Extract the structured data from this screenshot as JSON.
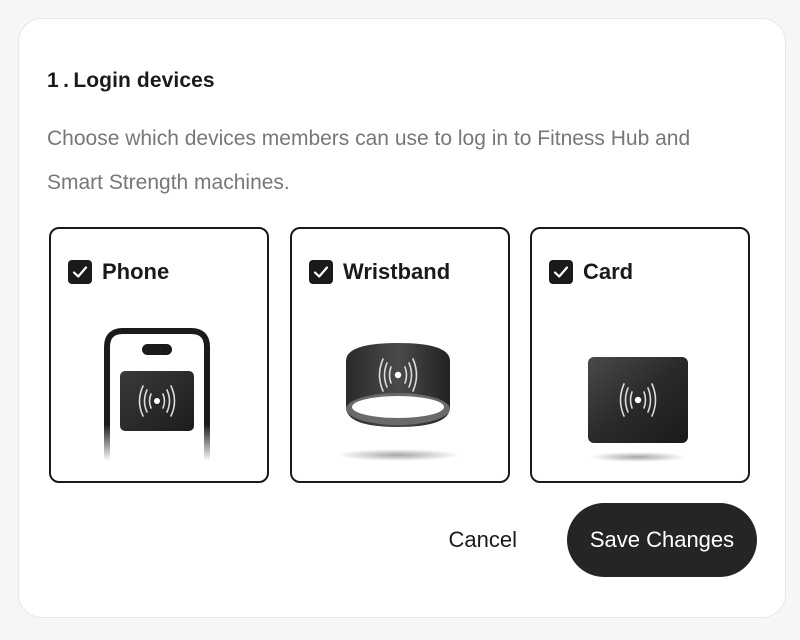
{
  "section": {
    "title": "1 . Login devices",
    "description": "Choose which devices members can use to log in to Fitness Hub and Smart Strength machines."
  },
  "devices": [
    {
      "label": "Phone",
      "checked": true,
      "icon": "phone-nfc-icon"
    },
    {
      "label": "Wristband",
      "checked": true,
      "icon": "wristband-nfc-icon"
    },
    {
      "label": "Card",
      "checked": true,
      "icon": "card-nfc-icon"
    }
  ],
  "actions": {
    "cancel_label": "Cancel",
    "save_label": "Save Changes"
  },
  "colors": {
    "primary": "#252525",
    "text_muted": "#777777",
    "border": "#1a1a1a"
  }
}
